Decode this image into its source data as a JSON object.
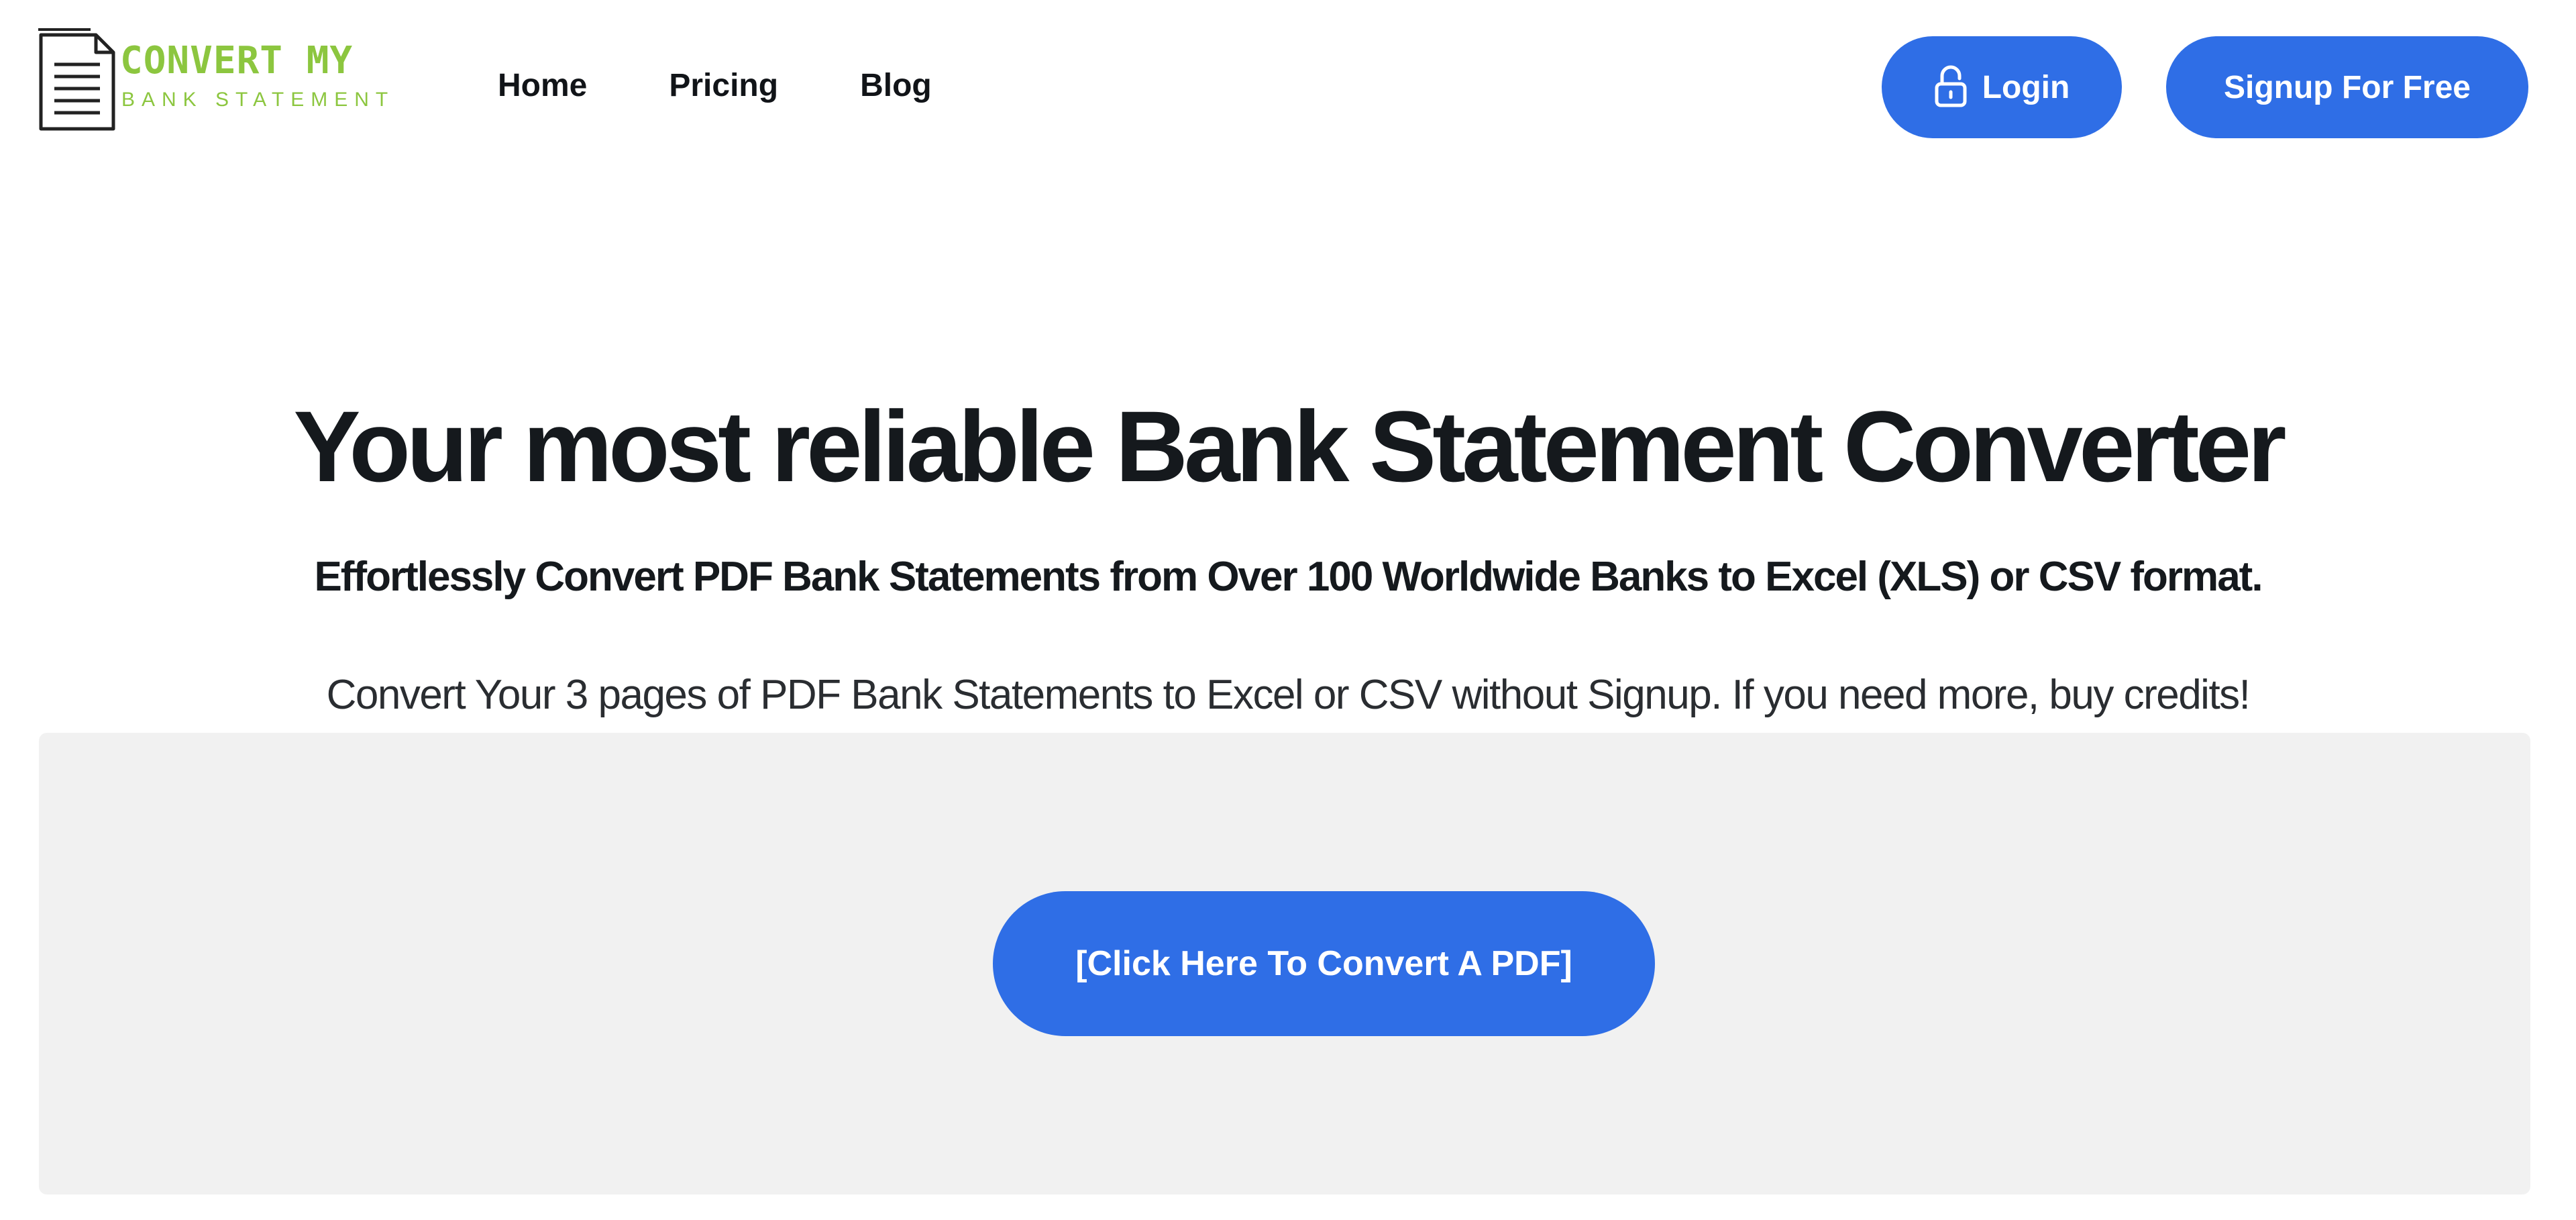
{
  "logo": {
    "line1": "CONVERT MY",
    "line2": "BANK STATEMENT",
    "color": "#8cc63f"
  },
  "nav": {
    "items": [
      {
        "label": "Home"
      },
      {
        "label": "Pricing"
      },
      {
        "label": "Blog"
      }
    ]
  },
  "header_actions": {
    "login_label": "Login",
    "login_icon": "lock-icon",
    "signup_label": "Signup For Free"
  },
  "hero": {
    "title": "Your most reliable Bank Statement Converter",
    "subtitle": "Effortlessly Convert PDF Bank Statements from Over 100 Worldwide Banks to Excel (XLS) or CSV format.",
    "note": "Convert Your 3 pages of PDF Bank Statements to Excel or CSV without Signup. If you need more, buy credits!"
  },
  "upload": {
    "button_label": "[Click Here To Convert A PDF]"
  },
  "colors": {
    "accent": "#2f6ee6",
    "panel_background": "#f1f1f1",
    "text": "#15191d"
  }
}
